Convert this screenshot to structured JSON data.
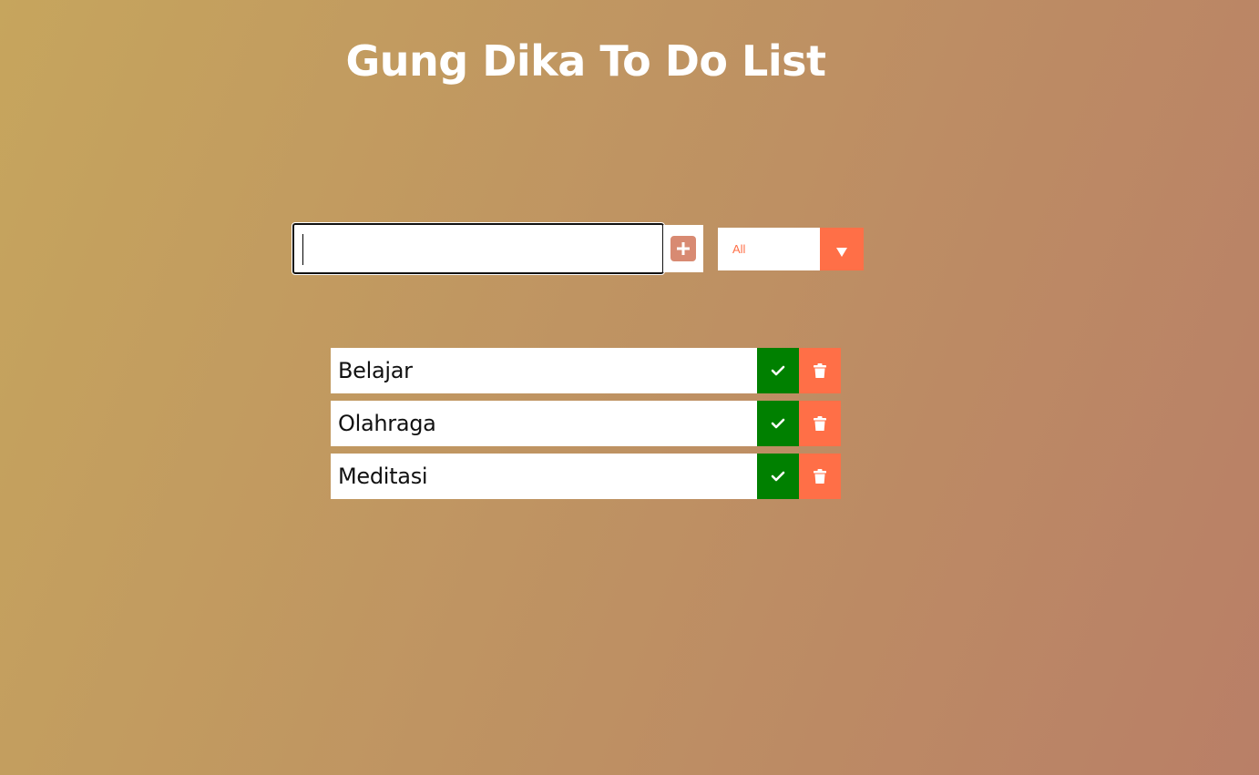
{
  "app": {
    "title": "Gung Dika To Do List"
  },
  "form": {
    "input_value": "",
    "add_icon": "plus-square-icon"
  },
  "filter": {
    "selected": "All",
    "arrow_icon": "caret-down-icon"
  },
  "todos": [
    {
      "text": "Belajar",
      "complete_icon": "check-icon",
      "delete_icon": "trash-icon"
    },
    {
      "text": "Olahraga",
      "complete_icon": "check-icon",
      "delete_icon": "trash-icon"
    },
    {
      "text": "Meditasi",
      "complete_icon": "check-icon",
      "delete_icon": "trash-icon"
    }
  ],
  "colors": {
    "accent": "#ff6f47",
    "complete": "#008000",
    "add_button": "#d88a72",
    "title": "#ffffff"
  }
}
